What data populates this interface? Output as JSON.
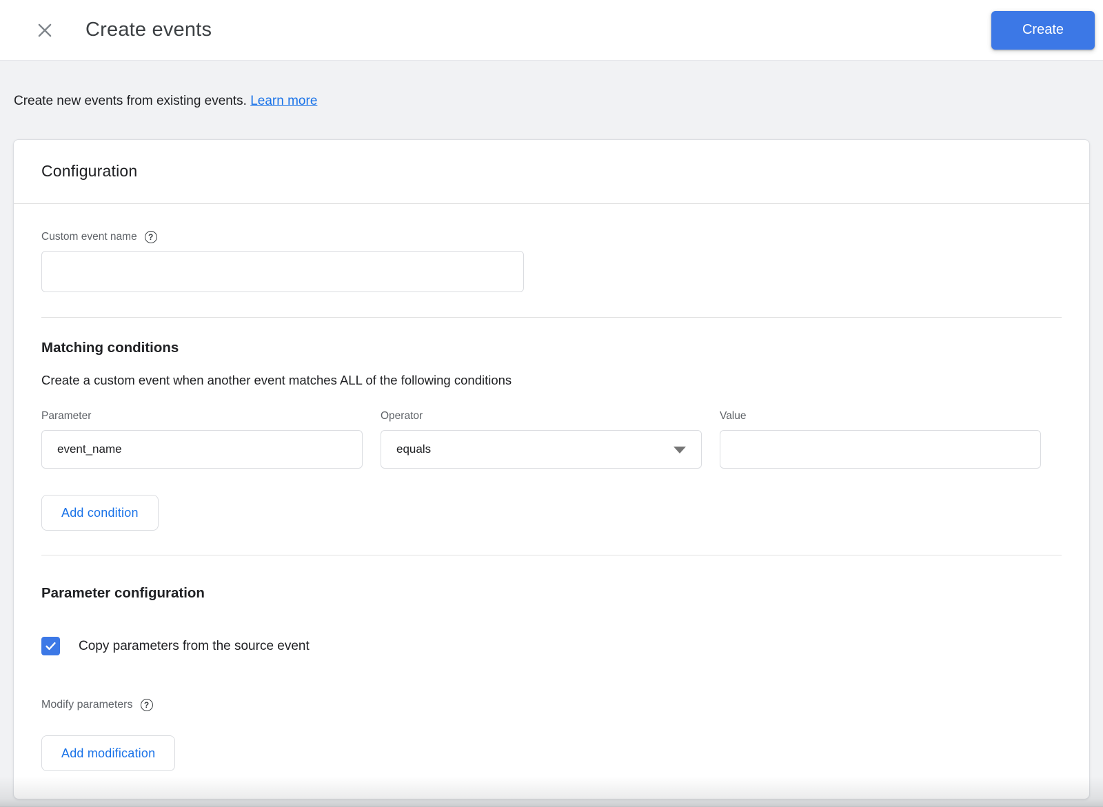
{
  "header": {
    "title": "Create events",
    "create_button_label": "Create"
  },
  "intro": {
    "text": "Create new events from existing events.",
    "link_label": "Learn more"
  },
  "configuration": {
    "section_title": "Configuration",
    "custom_event_name": {
      "label": "Custom event name",
      "value": ""
    },
    "matching_conditions": {
      "title": "Matching conditions",
      "description": "Create a custom event when another event matches ALL of the following conditions",
      "condition": {
        "parameter": {
          "label": "Parameter",
          "value": "event_name"
        },
        "operator": {
          "label": "Operator",
          "value": "equals"
        },
        "value": {
          "label": "Value",
          "value": ""
        }
      },
      "add_condition_label": "Add condition"
    },
    "parameter_configuration": {
      "title": "Parameter configuration",
      "copy_parameters": {
        "label": "Copy parameters from the source event",
        "checked": true
      },
      "modify_parameters_label": "Modify parameters",
      "add_modification_label": "Add modification"
    }
  },
  "colors": {
    "accent_blue": "#3c78e6",
    "link_blue": "#1a73e8",
    "button_text_blue": "#1a73e8",
    "page_background": "#f1f2f4",
    "card_background": "#ffffff",
    "divider": "#e0e0e0",
    "label_gray": "#5f6368",
    "text_dark": "#202124"
  }
}
